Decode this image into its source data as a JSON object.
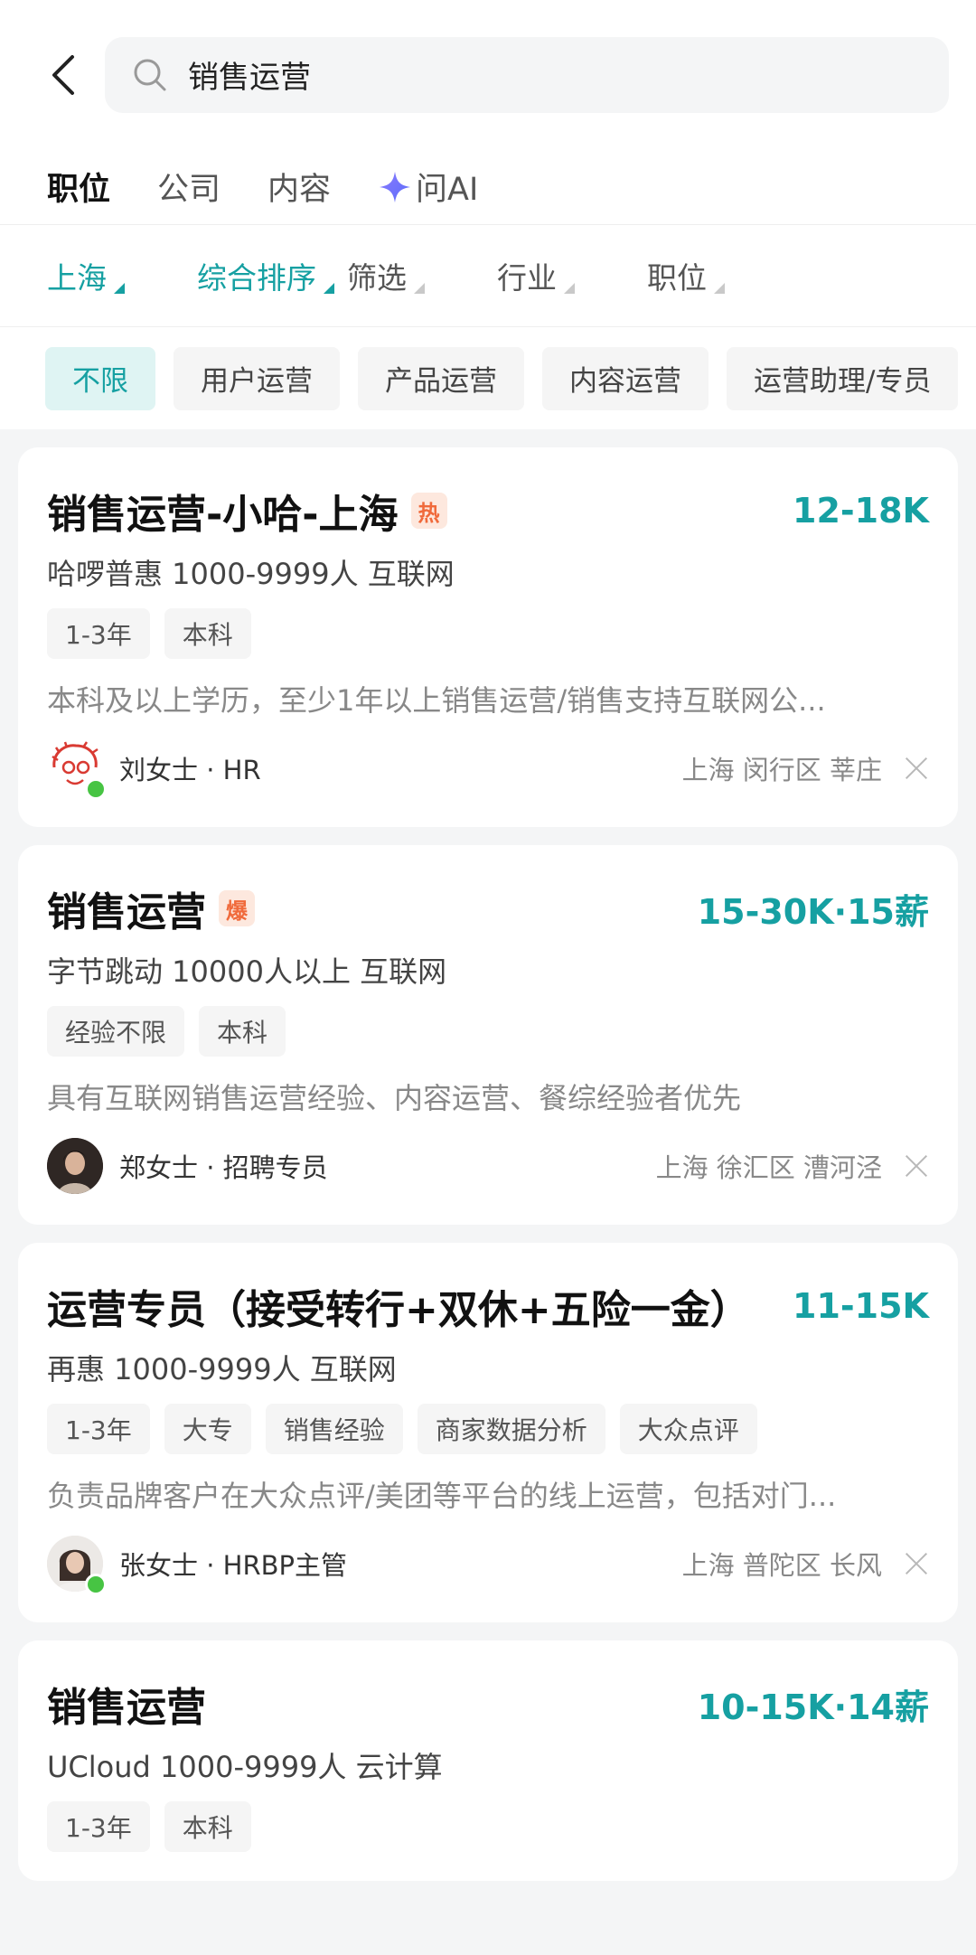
{
  "search": {
    "query": "销售运营"
  },
  "tabs": [
    {
      "label": "职位",
      "active": true
    },
    {
      "label": "公司",
      "active": false
    },
    {
      "label": "内容",
      "active": false
    },
    {
      "label": "问AI",
      "active": false,
      "icon": "ai-star-icon"
    }
  ],
  "filters": [
    {
      "label": "上海",
      "active": true
    },
    {
      "label": "综合排序",
      "active": true
    },
    {
      "label": "筛选",
      "active": false
    },
    {
      "label": "行业",
      "active": false
    },
    {
      "label": "职位",
      "active": false
    }
  ],
  "chips": [
    {
      "label": "不限",
      "active": true
    },
    {
      "label": "用户运营",
      "active": false
    },
    {
      "label": "产品运营",
      "active": false
    },
    {
      "label": "内容运营",
      "active": false
    },
    {
      "label": "运营助理/专员",
      "active": false
    }
  ],
  "colors": {
    "accent": "#16a0a2",
    "hot_badge_bg": "#fde8de",
    "hot_badge_text": "#f06a3b",
    "online": "#47c443"
  },
  "jobs": [
    {
      "title": "销售运营-小哈-上海",
      "badge": "热",
      "salary": "12-18K",
      "company": "哈啰普惠 1000-9999人 互联网",
      "tags": [
        "1-3年",
        "本科"
      ],
      "desc": "本科及以上学历，至少1年以上销售运营/销售支持互联网公...",
      "recruiter": "刘女士 · HR",
      "location": "上海 闵行区 莘庄",
      "online": true
    },
    {
      "title": "销售运营",
      "badge": "爆",
      "salary": "15-30K·15薪",
      "company": "字节跳动 10000人以上 互联网",
      "tags": [
        "经验不限",
        "本科"
      ],
      "desc": "具有互联网销售运营经验、内容运营、餐综经验者优先",
      "recruiter": "郑女士 · 招聘专员",
      "location": "上海 徐汇区 漕河泾",
      "online": false
    },
    {
      "title": "运营专员（接受转行+双休+五险一金）",
      "badge": "",
      "salary": "11-15K",
      "company": "再惠 1000-9999人 互联网",
      "tags": [
        "1-3年",
        "大专",
        "销售经验",
        "商家数据分析",
        "大众点评"
      ],
      "desc": "负责品牌客户在大众点评/美团等平台的线上运营，包括对门...",
      "recruiter": "张女士 · HRBP主管",
      "location": "上海 普陀区 长风",
      "online": true
    },
    {
      "title": "销售运营",
      "badge": "",
      "salary": "10-15K·14薪",
      "company": "UCloud 1000-9999人 云计算",
      "tags": [
        "1-3年",
        "本科"
      ],
      "desc": "",
      "recruiter": "",
      "location": "",
      "online": false
    }
  ]
}
